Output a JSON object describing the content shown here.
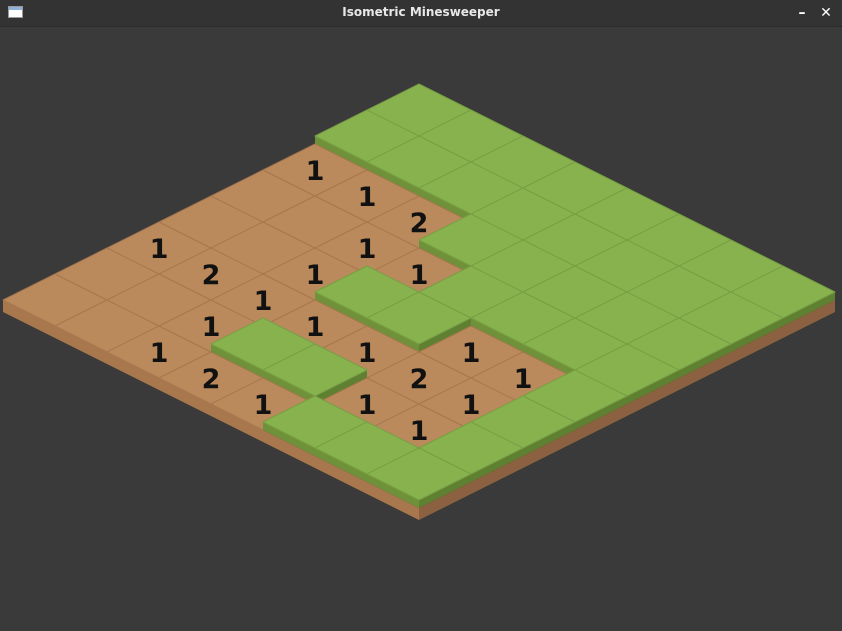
{
  "window": {
    "title": "Isometric Minesweeper",
    "minimize_glyph": "–",
    "close_glyph": "✕"
  },
  "colors": {
    "grass_top": "#88b24d",
    "grass_edge": "#6e9139",
    "grass_line": "#77a044",
    "dirt_top": "#bb8a5c",
    "dirt_line": "#a6784e",
    "side_light": "#a8774e",
    "side_dark": "#8c6142",
    "number": "#111111",
    "background": "#3a3a3a"
  },
  "board": {
    "rows": 8,
    "cols": 8,
    "tiles": [
      [
        "H",
        "H",
        "H",
        "H",
        "H",
        "H",
        "H",
        "H"
      ],
      [
        "H",
        "H",
        "H",
        "H",
        "H",
        "H",
        "H",
        "H"
      ],
      [
        "1",
        "1",
        "2",
        "H",
        "H",
        "H",
        "H",
        "H"
      ],
      [
        "0",
        "0",
        "1",
        "1",
        "H",
        "H",
        "H",
        "H"
      ],
      [
        "0",
        "0",
        "1",
        "H",
        "H",
        "1",
        "1",
        "H"
      ],
      [
        "1",
        "2",
        "1",
        "1",
        "1",
        "2",
        "1",
        "H"
      ],
      [
        "0",
        "0",
        "1",
        "H",
        "H",
        "1",
        "1",
        "H"
      ],
      [
        "0",
        "0",
        "1",
        "2",
        "1",
        "H",
        "H",
        "H"
      ]
    ]
  }
}
